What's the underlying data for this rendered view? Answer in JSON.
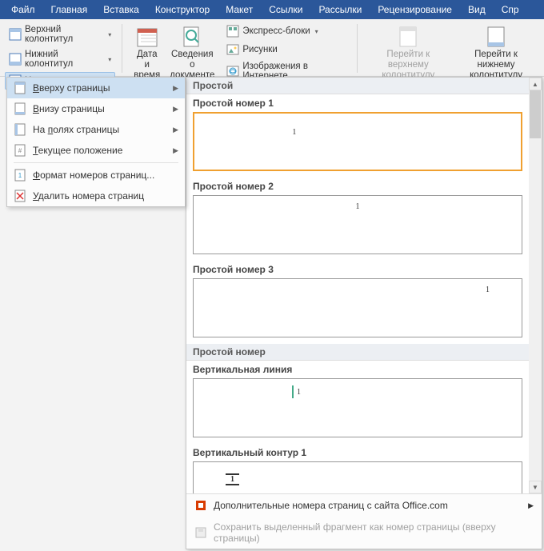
{
  "menubar": [
    "Файл",
    "Главная",
    "Вставка",
    "Конструктор",
    "Макет",
    "Ссылки",
    "Рассылки",
    "Рецензирование",
    "Вид",
    "Спр"
  ],
  "ribbon": {
    "header_top": "Верхний колонтитул",
    "header_bottom": "Нижний колонтитул",
    "page_number": "Номер страницы",
    "date_time": "Дата и\nвремя",
    "doc_info": "Сведения о\nдокументе",
    "quick_parts": "Экспресс-блоки",
    "pictures": "Рисунки",
    "online_pics": "Изображения в Интернете",
    "goto_header": "Перейти к верхнему\nколонтитулу",
    "goto_footer": "Перейти к нижнему\nколонтитулу"
  },
  "submenu": {
    "top": "Вверху страницы",
    "bottom": "Внизу страницы",
    "margins": "На полях страницы",
    "current": "Текущее положение",
    "format": "Формат номеров страниц...",
    "remove": "Удалить номера страниц",
    "accel": {
      "top": "В",
      "bottom": "В",
      "margins": "п",
      "current": "Т",
      "format": "Ф",
      "remove": "У"
    }
  },
  "gallery": {
    "section1": "Простой",
    "items1": [
      {
        "title": "Простой номер 1",
        "pos": "center",
        "value": "1"
      },
      {
        "title": "Простой номер 2",
        "pos": "center-wide",
        "value": "1"
      },
      {
        "title": "Простой номер 3",
        "pos": "right",
        "value": "1"
      }
    ],
    "section2": "Простой номер",
    "items2": [
      {
        "title": "Вертикальная линия",
        "pos": "vline",
        "value": "1"
      },
      {
        "title": "Вертикальный контур 1",
        "pos": "voutline",
        "value": "1"
      }
    ]
  },
  "footer": {
    "more": "Дополнительные номера страниц с сайта Office.com",
    "save": "Сохранить выделенный фрагмент как номер страницы (вверху страницы)"
  }
}
